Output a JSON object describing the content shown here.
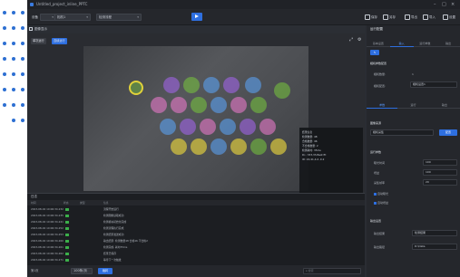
{
  "window": {
    "title": "Untitled_project_inline_PPTC"
  },
  "toolbar": {
    "device_label": "设备",
    "device_value": "相机1",
    "mode_value": "检测流程",
    "right_tools": [
      "保存",
      "另存",
      "导出",
      "导入",
      "设置"
    ]
  },
  "left_panel": {
    "title": "图像显示",
    "btn_single": "单次运行",
    "btn_continuous": "连续运行"
  },
  "overlay": {
    "lines": [
      "结果信息",
      "检测数量: 48",
      "合格数量: 46",
      "不合格数量: 2",
      "检测耗时: 35ms",
      "Dr.: 333,33,Best fit",
      "ID: 22,41,4.4 ,0.2"
    ]
  },
  "log": {
    "title": "日志",
    "cols": [
      "时间",
      "状态",
      "类型",
      "信息"
    ],
    "rows": [
      {
        "time": "2023-08-02 10:06:34.232",
        "msg": "流程开始运行"
      },
      {
        "time": "2023-08-02 10:06:34.235",
        "msg": "检测图像读取成功"
      },
      {
        "time": "2023-08-02 10:06:34.241",
        "msg": "检测模块初始化完成"
      },
      {
        "time": "2023-08-02 10:06:34.252",
        "msg": "检测流程执行完成"
      },
      {
        "time": "2023-08-02 10:06:34.253",
        "msg": "检测结果发送成功"
      },
      {
        "time": "2023-08-02 10:06:34.260",
        "msg": "输出结果: 检测数量48 合格46 不合格2"
      },
      {
        "time": "2023-08-02 10:06:34.261",
        "msg": "检测完成, 耗时35ms"
      },
      {
        "time": "2023-08-02 10:06:34.262",
        "msg": "结果已保存"
      },
      {
        "time": "2023-08-02 10:06:34.271",
        "msg": "等待下一次触发"
      }
    ]
  },
  "bottombar": {
    "page": "第1页",
    "size": "100条/页",
    "go": "跳转",
    "search_placeholder": "搜索"
  },
  "right_panel": {
    "header": "运行配置",
    "tabs": [
      "基本设置",
      "输入",
      "运行参数",
      "输出"
    ],
    "section1": "相机参数配置",
    "row1_label": "相机数量:",
    "row1_value": "1",
    "row2_label": "相机配置:",
    "row2_value": "相机设置1",
    "tabs2": [
      "参数",
      "运行",
      "输出"
    ],
    "section2": "图像来源",
    "source_value": "相机采集",
    "source_btn": "配置",
    "section3": "运行参数",
    "f1_label": "曝光时间",
    "f1_value": "100",
    "f2_label": "增益",
    "f2_value": "100",
    "f3_label": "采集帧率",
    "f3_value": "20",
    "chk1": "自动曝光",
    "chk2": "自动增益",
    "section4": "输出设置",
    "o1_label": "输出结果",
    "o1_value": "检测结果",
    "o2_label": "输出路径",
    "o2_value": "D:\\Data"
  },
  "colors": {
    "accent": "#2e6fe0",
    "bg": "#2a2d33"
  }
}
